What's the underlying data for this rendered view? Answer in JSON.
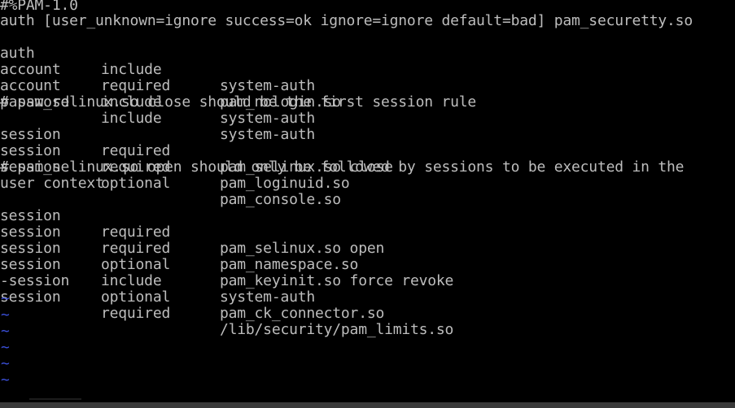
{
  "file": {
    "header": "#%PAM-1.0",
    "line_securetty": "auth [user_unknown=ignore success=ok ignore=ignore default=bad] pam_securetty.so",
    "comment_close": "# pam_selinux.so close should be the first session rule",
    "comment_open_1": "# pam_selinux.so open should only be followed by sessions to be executed in the",
    "comment_open_2": "user context",
    "rules_a": [
      {
        "type": "auth",
        "control": "include",
        "module": "system-auth"
      },
      {
        "type": "account",
        "control": "required",
        "module": "pam_nologin.so"
      },
      {
        "type": "account",
        "control": "include",
        "module": "system-auth"
      },
      {
        "type": "password",
        "control": "include",
        "module": "system-auth"
      }
    ],
    "rules_b": [
      {
        "type": "session",
        "control": "required",
        "module": "pam_selinux.so close"
      },
      {
        "type": "session",
        "control": "required",
        "module": "pam_loginuid.so"
      },
      {
        "type": "session",
        "control": "optional",
        "module": "pam_console.so"
      }
    ],
    "rules_c": [
      {
        "type": "session",
        "control": "required",
        "module": "pam_selinux.so open"
      },
      {
        "type": "session",
        "control": "required",
        "module": "pam_namespace.so"
      },
      {
        "type": "session",
        "control": "optional",
        "module": "pam_keyinit.so force revoke"
      },
      {
        "type": "session",
        "control": "include",
        "module": "system-auth"
      },
      {
        "type": "-session",
        "control": "optional",
        "module": "pam_ck_connector.so"
      },
      {
        "type": "session",
        "control": "required",
        "module": "/lib/security/pam_limits.so"
      }
    ]
  },
  "empty_line_marker": "~",
  "colors": {
    "background": "#000000",
    "text": "#bdbdbd",
    "tilde": "#3a4fd8"
  }
}
